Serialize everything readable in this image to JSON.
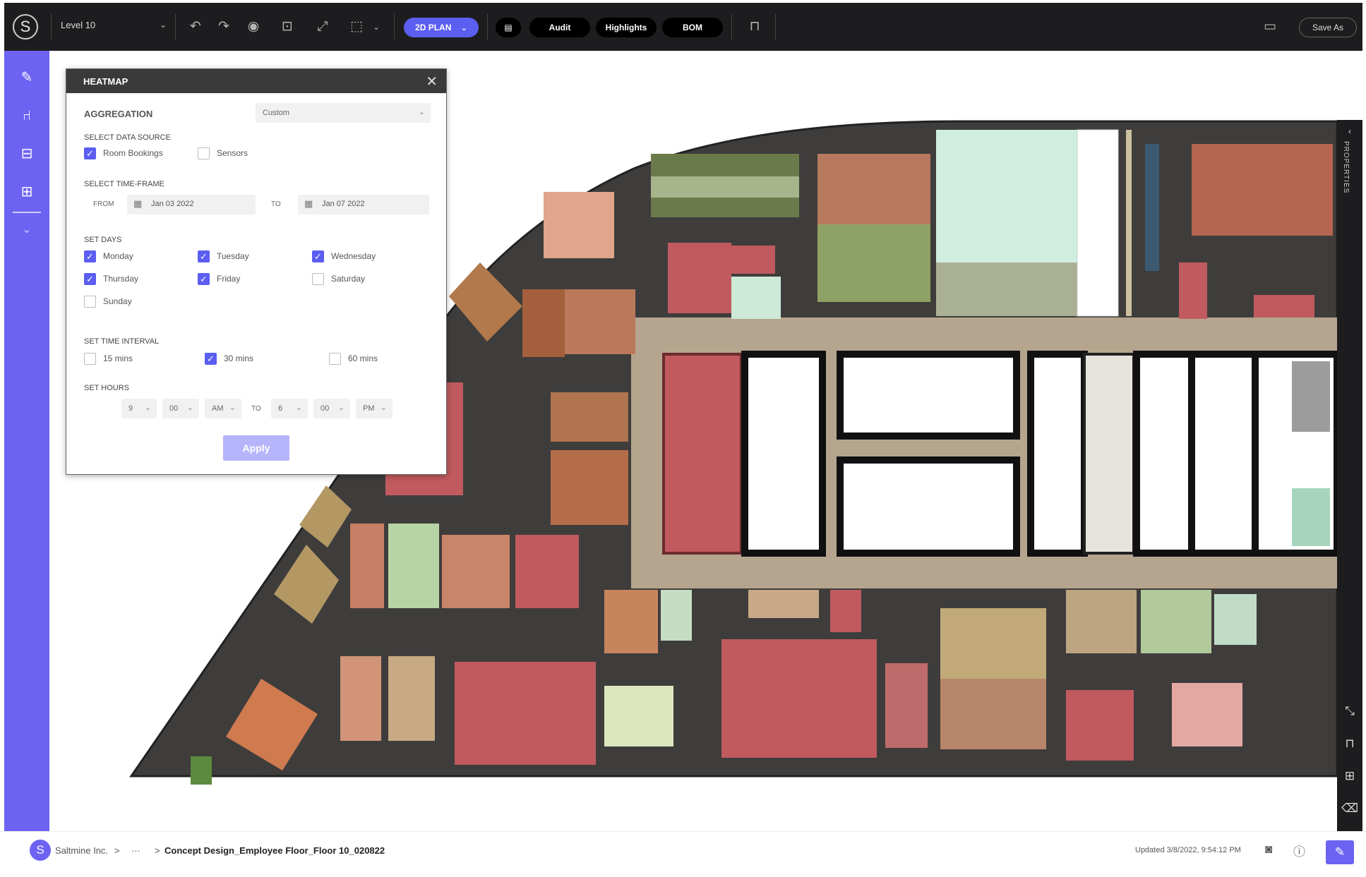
{
  "topbar": {
    "level": "Level 10",
    "plan_label": "2D PLAN",
    "audit_label": "Audit",
    "highlights_label": "Highlights",
    "bom_label": "BOM",
    "save_as_label": "Save As",
    "icons": [
      "undo-icon",
      "redo-icon",
      "eye-icon",
      "screenshot-icon",
      "fullscreen-icon",
      "select-icon",
      "comment-icon",
      "lock-icon",
      "feedback-icon"
    ]
  },
  "leftrail": {
    "icons": [
      "pencil-icon",
      "chair-icon",
      "layout-icon",
      "table-icon",
      "expand-down-icon"
    ]
  },
  "heatmap": {
    "title": "HEATMAP",
    "aggregation_label": "AGGREGATION",
    "aggregation_value": "Custom",
    "data_source_label": "SELECT DATA SOURCE",
    "sources": [
      {
        "label": "Room Bookings",
        "checked": true
      },
      {
        "label": "Sensors",
        "checked": false
      }
    ],
    "timeframe_label": "SELECT TIME-FRAME",
    "from_label": "FROM",
    "from_date": "Jan 03 2022",
    "to_label": "TO",
    "to_date": "Jan 07 2022",
    "days_label": "SET DAYS",
    "days": [
      {
        "label": "Monday",
        "checked": true
      },
      {
        "label": "Tuesday",
        "checked": true
      },
      {
        "label": "Wednesday",
        "checked": true
      },
      {
        "label": "Thursday",
        "checked": true
      },
      {
        "label": "Friday",
        "checked": true
      },
      {
        "label": "Saturday",
        "checked": false
      },
      {
        "label": "Sunday",
        "checked": false
      }
    ],
    "interval_label": "SET TIME INTERVAL",
    "intervals": [
      {
        "label": "15 mins",
        "checked": false
      },
      {
        "label": "30 mins",
        "checked": true
      },
      {
        "label": "60 mins",
        "checked": false
      }
    ],
    "hours_label": "SET HOURS",
    "start_hour": "9",
    "start_min": "00",
    "start_ampm": "AM",
    "hours_to": "TO",
    "end_hour": "6",
    "end_min": "00",
    "end_ampm": "PM",
    "apply_label": "Apply"
  },
  "rightstrip": {
    "label": "PROPERTIES"
  },
  "bottombar": {
    "logo_letter": "S",
    "company": "Saltmine Inc.",
    "sep1": ">",
    "ellipsis": "···",
    "sep2": ">",
    "project": "Concept Design_Employee Floor_Floor 10_020822",
    "updated": "Updated 3/8/2022, 9:54:12 PM"
  }
}
